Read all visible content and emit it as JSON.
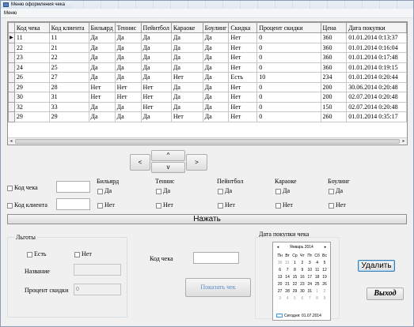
{
  "window": {
    "title": "Меню оформления чека",
    "menu": "Меню"
  },
  "grid": {
    "columns": [
      "Код чека",
      "Код клиента",
      "Бильярд",
      "Теннис",
      "Пейнтбол",
      "Караоке",
      "Боулинг",
      "Скидка",
      "Процент скидки",
      "Цена",
      "Дата покупки"
    ],
    "current_row_marker": "▶",
    "rows": [
      [
        "11",
        "11",
        "Да",
        "Да",
        "Да",
        "Да",
        "Да",
        "Нет",
        "0",
        "360",
        "01.01.2014 0:13:37"
      ],
      [
        "22",
        "21",
        "Да",
        "Да",
        "Да",
        "Да",
        "Да",
        "Нет",
        "0",
        "360",
        "01.01.2014 0:16:04"
      ],
      [
        "23",
        "22",
        "Да",
        "Да",
        "Да",
        "Да",
        "Да",
        "Нет",
        "0",
        "360",
        "01.01.2014 0:17:48"
      ],
      [
        "24",
        "25",
        "Да",
        "Да",
        "Да",
        "Да",
        "Да",
        "Нет",
        "0",
        "360",
        "01.01.2014 0:19:15"
      ],
      [
        "26",
        "27",
        "Да",
        "Да",
        "Да",
        "Нет",
        "Да",
        "Есть",
        "10",
        "234",
        "01.01.2014 0:20:44"
      ],
      [
        "29",
        "28",
        "Нет",
        "Нет",
        "Нет",
        "Да",
        "Да",
        "Нет",
        "0",
        "200",
        "30.06.2014 0:20:48"
      ],
      [
        "30",
        "31",
        "Нет",
        "Нет",
        "Нет",
        "Да",
        "Да",
        "Нет",
        "0",
        "200",
        "02.07.2014 0:20:48"
      ],
      [
        "32",
        "33",
        "Да",
        "Да",
        "Нет",
        "Да",
        "Да",
        "Нет",
        "0",
        "150",
        "02.07.2014 0:20:48"
      ],
      [
        "29",
        "29",
        "Да",
        "Да",
        "Да",
        "Нет",
        "Да",
        "Нет",
        "0",
        "260",
        "01.01.2014 0:35:17"
      ]
    ]
  },
  "nav": {
    "prev": "<",
    "up": "^",
    "down": "v",
    "next": ">"
  },
  "filter": {
    "check_code": "Код чека",
    "client_code": "Код клиента",
    "services": [
      {
        "name": "Бильярд",
        "yes": "Да",
        "no": "Нет"
      },
      {
        "name": "Теннис",
        "yes": "Да",
        "no": "Нет"
      },
      {
        "name": "Пейнтбол",
        "yes": "Да",
        "no": "Нет"
      },
      {
        "name": "Караоке",
        "yes": "Да",
        "no": "Нет"
      },
      {
        "name": "Боулинг",
        "yes": "Да",
        "no": "Нет"
      }
    ]
  },
  "press_button": "Нажать",
  "benefits": {
    "title": "Льготы",
    "yes": "Есть",
    "no": "Нет",
    "name_label": "Название",
    "percent_label": "Процент скидки",
    "percent_value": "0"
  },
  "check": {
    "label": "Код чека",
    "show_button": "Показать чек"
  },
  "calendar": {
    "title": "Дата покупки чека",
    "month": "Январь 2014",
    "prev": "◂",
    "next": "▸",
    "weekdays": [
      "Пн",
      "Вт",
      "Ср",
      "Чт",
      "Пт",
      "Сб",
      "Вс"
    ],
    "weeks": [
      [
        "30",
        "31",
        "1",
        "2",
        "3",
        "4",
        "5"
      ],
      [
        "6",
        "7",
        "8",
        "9",
        "10",
        "11",
        "12"
      ],
      [
        "13",
        "14",
        "15",
        "16",
        "17",
        "18",
        "19"
      ],
      [
        "20",
        "21",
        "22",
        "23",
        "24",
        "25",
        "26"
      ],
      [
        "27",
        "28",
        "29",
        "30",
        "31",
        "1",
        "2"
      ],
      [
        "3",
        "4",
        "5",
        "6",
        "7",
        "8",
        "9"
      ]
    ],
    "today": "Сегодня: 01.07.2014"
  },
  "actions": {
    "delete": "Удалить",
    "exit": "Выход"
  }
}
